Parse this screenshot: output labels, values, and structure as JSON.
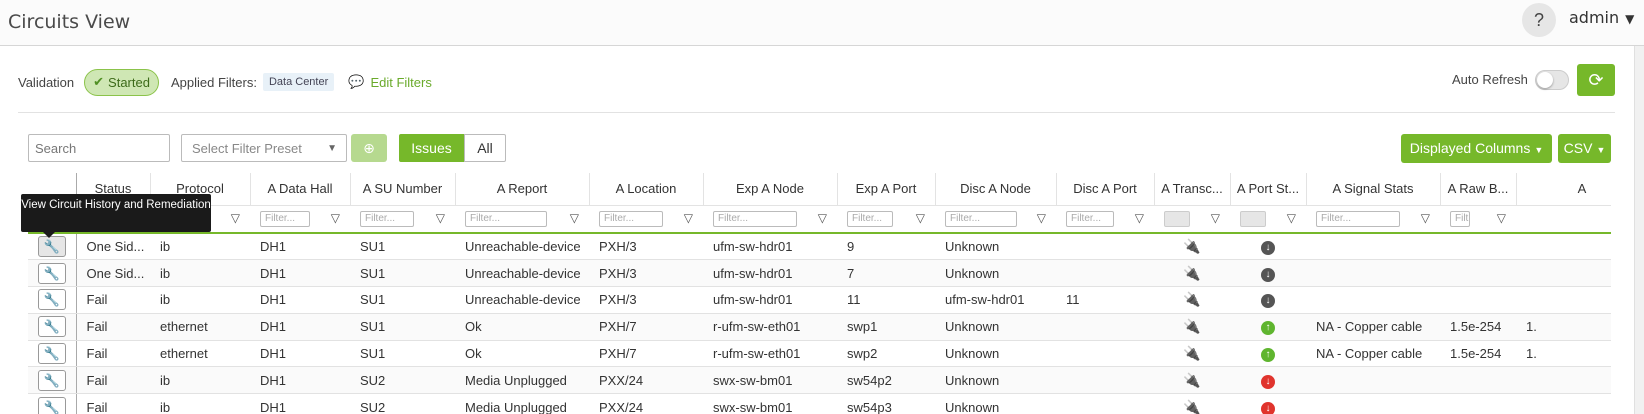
{
  "header": {
    "title": "Circuits View",
    "help": "?",
    "user": "admin"
  },
  "validation": {
    "label": "Validation",
    "status": "Started",
    "applied_filters_label": "Applied Filters:",
    "filter_chip": "Data Center",
    "edit_filters": "Edit Filters",
    "auto_refresh_label": "Auto Refresh",
    "auto_refresh_on": false
  },
  "toolbar": {
    "search_placeholder": "Search",
    "preset_placeholder": "Select Filter Preset",
    "issues_label": "Issues",
    "all_label": "All",
    "columns_label": "Displayed Columns",
    "csv_label": "CSV"
  },
  "tooltip": {
    "text": "View Circuit History and Remediation"
  },
  "colors": {
    "accent": "#76b82a",
    "error": "#e0342d"
  },
  "table": {
    "columns": [
      "",
      "Status",
      "Protocol",
      "A Data Hall",
      "A SU Number",
      "A Report",
      "A Location",
      "Exp A Node",
      "Exp A Port",
      "Disc A Node",
      "Disc A Port",
      "A Transc...",
      "A Port St...",
      "A Signal Stats",
      "A Raw B...",
      "A"
    ],
    "filter_placeholders": [
      "",
      "",
      "",
      "Filter...",
      "Filter...",
      "Filter...",
      "Filter...",
      "Filter...",
      "Filter...",
      "Filter...",
      "Filter...",
      "",
      "",
      "Filter...",
      "Filt",
      ""
    ],
    "rows": [
      {
        "status": "One Sid...",
        "status_type": "normal",
        "protocol": "ib",
        "hall": "DH1",
        "su": "SU1",
        "report": "Unreachable-device",
        "location": "PXH/3",
        "exp_node": "ufm-sw-hdr01",
        "exp_port": "9",
        "disc_node": "Unknown",
        "disc_unknown": true,
        "disc_port": "",
        "transceiver_icon": "plug-icon",
        "transceiver_color": "gray",
        "port_state_icon": "arrow-down-icon",
        "port_state_color": "gray",
        "signal": "",
        "raw": "",
        "extra": ""
      },
      {
        "status": "One Sid...",
        "status_type": "normal",
        "protocol": "ib",
        "hall": "DH1",
        "su": "SU1",
        "report": "Unreachable-device",
        "location": "PXH/3",
        "exp_node": "ufm-sw-hdr01",
        "exp_port": "7",
        "disc_node": "Unknown",
        "disc_unknown": true,
        "disc_port": "",
        "transceiver_icon": "plug-icon",
        "transceiver_color": "gray",
        "port_state_icon": "arrow-down-icon",
        "port_state_color": "gray",
        "signal": "",
        "raw": "",
        "extra": ""
      },
      {
        "status": "Fail",
        "status_type": "fail",
        "protocol": "ib",
        "hall": "DH1",
        "su": "SU1",
        "report": "Unreachable-device",
        "location": "PXH/3",
        "exp_node": "ufm-sw-hdr01",
        "exp_port": "11",
        "disc_node": "ufm-sw-hdr01",
        "disc_unknown": false,
        "disc_port": "11",
        "transceiver_icon": "plug-icon",
        "transceiver_color": "gray",
        "port_state_icon": "arrow-down-icon",
        "port_state_color": "gray",
        "signal": "",
        "raw": "",
        "extra": ""
      },
      {
        "status": "Fail",
        "status_type": "fail",
        "protocol": "ethernet",
        "hall": "DH1",
        "su": "SU1",
        "report": "Ok",
        "location": "PXH/7",
        "exp_node": "r-ufm-sw-eth01",
        "exp_port": "swp1",
        "disc_node": "Unknown",
        "disc_unknown": true,
        "disc_port": "",
        "transceiver_icon": "plug-icon",
        "transceiver_color": "green",
        "port_state_icon": "arrow-up-icon",
        "port_state_color": "green",
        "signal": "NA - Copper cable",
        "raw": "1.5e-254",
        "extra": "1."
      },
      {
        "status": "Fail",
        "status_type": "fail",
        "protocol": "ethernet",
        "hall": "DH1",
        "su": "SU1",
        "report": "Ok",
        "location": "PXH/7",
        "exp_node": "r-ufm-sw-eth01",
        "exp_port": "swp2",
        "disc_node": "Unknown",
        "disc_unknown": true,
        "disc_port": "",
        "transceiver_icon": "plug-icon",
        "transceiver_color": "green",
        "port_state_icon": "arrow-up-icon",
        "port_state_color": "green",
        "signal": "NA - Copper cable",
        "raw": "1.5e-254",
        "extra": "1."
      },
      {
        "status": "Fail",
        "status_type": "fail",
        "protocol": "ib",
        "hall": "DH1",
        "su": "SU2",
        "report": "Media Unplugged",
        "location": "PXX/24",
        "exp_node": "swx-sw-bm01",
        "exp_port": "sw54p2",
        "disc_node": "Unknown",
        "disc_unknown": true,
        "disc_port": "",
        "transceiver_icon": "plug-icon",
        "transceiver_color": "red",
        "port_state_icon": "arrow-down-icon",
        "port_state_color": "red",
        "signal": "",
        "raw": "",
        "extra": ""
      },
      {
        "status": "Fail",
        "status_type": "fail",
        "protocol": "ib",
        "hall": "DH1",
        "su": "SU2",
        "report": "Media Unplugged",
        "location": "PXX/24",
        "exp_node": "swx-sw-bm01",
        "exp_port": "sw54p3",
        "disc_node": "Unknown",
        "disc_unknown": true,
        "disc_port": "",
        "transceiver_icon": "plug-icon",
        "transceiver_color": "red",
        "port_state_icon": "arrow-down-icon",
        "port_state_color": "red",
        "signal": "",
        "raw": "",
        "extra": ""
      }
    ]
  }
}
